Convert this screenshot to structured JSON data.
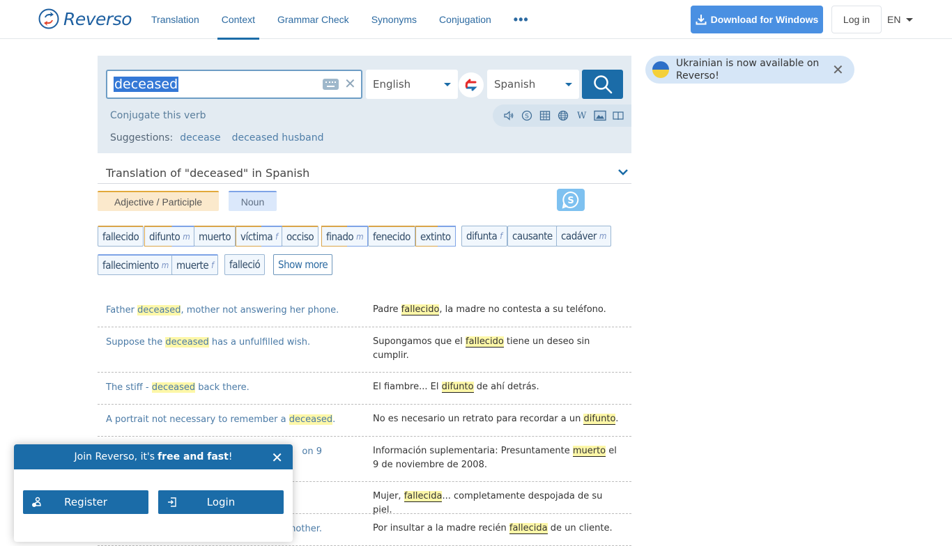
{
  "header": {
    "brand": "Reverso",
    "nav": [
      {
        "label": "Translation",
        "active": false
      },
      {
        "label": "Context",
        "active": true
      },
      {
        "label": "Grammar Check",
        "active": false
      },
      {
        "label": "Synonyms",
        "active": false
      },
      {
        "label": "Conjugation",
        "active": false
      }
    ],
    "more_label": "•••",
    "download_label": "Download for Windows",
    "login_label": "Log in",
    "lang_label": "EN"
  },
  "search": {
    "query": "deceased",
    "source_lang": "English",
    "target_lang": "Spanish",
    "conjugate_label": "Conjugate this verb",
    "suggestions_label": "Suggestions:",
    "suggestions": [
      "decease",
      "deceased husband"
    ],
    "tools": [
      "speaker-icon",
      "synonyms-icon",
      "table-icon",
      "globe-icon",
      "wikipedia-icon",
      "image-icon",
      "book-icon"
    ]
  },
  "notice": {
    "text": "Ukrainian is now available on Reverso!"
  },
  "translation": {
    "title": "Translation of \"deceased\" in Spanish",
    "pos_tabs": [
      "Adjective / Participle",
      "Noun"
    ],
    "chips_row1": [
      {
        "word": "fallecido",
        "gender": "",
        "type": "adj"
      },
      {
        "word": "difunto",
        "gender": "m",
        "type": "both"
      },
      {
        "word": "muerto",
        "gender": "",
        "type": "adj"
      },
      {
        "word": "víctima",
        "gender": "f",
        "type": "both"
      },
      {
        "word": "occiso",
        "gender": "",
        "type": "adj"
      },
      {
        "word": "finado",
        "gender": "m",
        "type": "both"
      },
      {
        "word": "fenecido",
        "gender": "",
        "type": "adj"
      },
      {
        "word": "extinto",
        "gender": "",
        "type": "both"
      },
      {
        "word": "difunta",
        "gender": "f",
        "type": "none"
      },
      {
        "word": "causante",
        "gender": "",
        "type": "none"
      },
      {
        "word": "cadáver",
        "gender": "m",
        "type": "none"
      }
    ],
    "chips_row2": [
      {
        "word": "fallecimiento",
        "gender": "m",
        "type": "noun"
      },
      {
        "word": "muerte",
        "gender": "f",
        "type": "noun"
      },
      {
        "word": "falleció",
        "gender": "",
        "type": "none"
      }
    ],
    "show_more_label": "Show more"
  },
  "examples": [
    {
      "src": [
        "Father ",
        "deceased",
        ", mother not answering her phone."
      ],
      "tgt": [
        "Padre ",
        "fallecido",
        ", la madre no contesta a su teléfono."
      ]
    },
    {
      "src": [
        "Suppose the ",
        "deceased",
        " has a unfulfilled wish."
      ],
      "tgt": [
        "Supongamos que el ",
        "fallecido",
        " tiene un deseo sin cumplir."
      ]
    },
    {
      "src": [
        "The stiff - ",
        "deceased",
        " back there."
      ],
      "tgt": [
        "El fiambre... El ",
        "difunto",
        " de ahí detrás."
      ]
    },
    {
      "src": [
        "A portrait not necessary to remember a ",
        "deceased",
        "."
      ],
      "tgt": [
        "No es necesario un retrato para recordar a un ",
        "difunto",
        "."
      ]
    },
    {
      "src": [
        "",
        "",
        "on 9"
      ],
      "tgt": [
        "Información suplementaria: Presuntamente ",
        "muerto",
        " el 9 de noviembre de 2008."
      ]
    },
    {
      "src": [
        "",
        "",
        ""
      ],
      "tgt": [
        "Mujer, ",
        "fallecida",
        "... completamente despojada de su piel."
      ]
    },
    {
      "src": [
        "",
        "",
        "mother."
      ],
      "tgt": [
        "Por insultar a la madre recién ",
        "fallecida",
        " de un cliente."
      ]
    }
  ],
  "popup": {
    "title_prefix": "Join Reverso, it's",
    "title_bold": "free and fast",
    "title_suffix": "!",
    "register_label": "Register",
    "login_label": "Login"
  }
}
